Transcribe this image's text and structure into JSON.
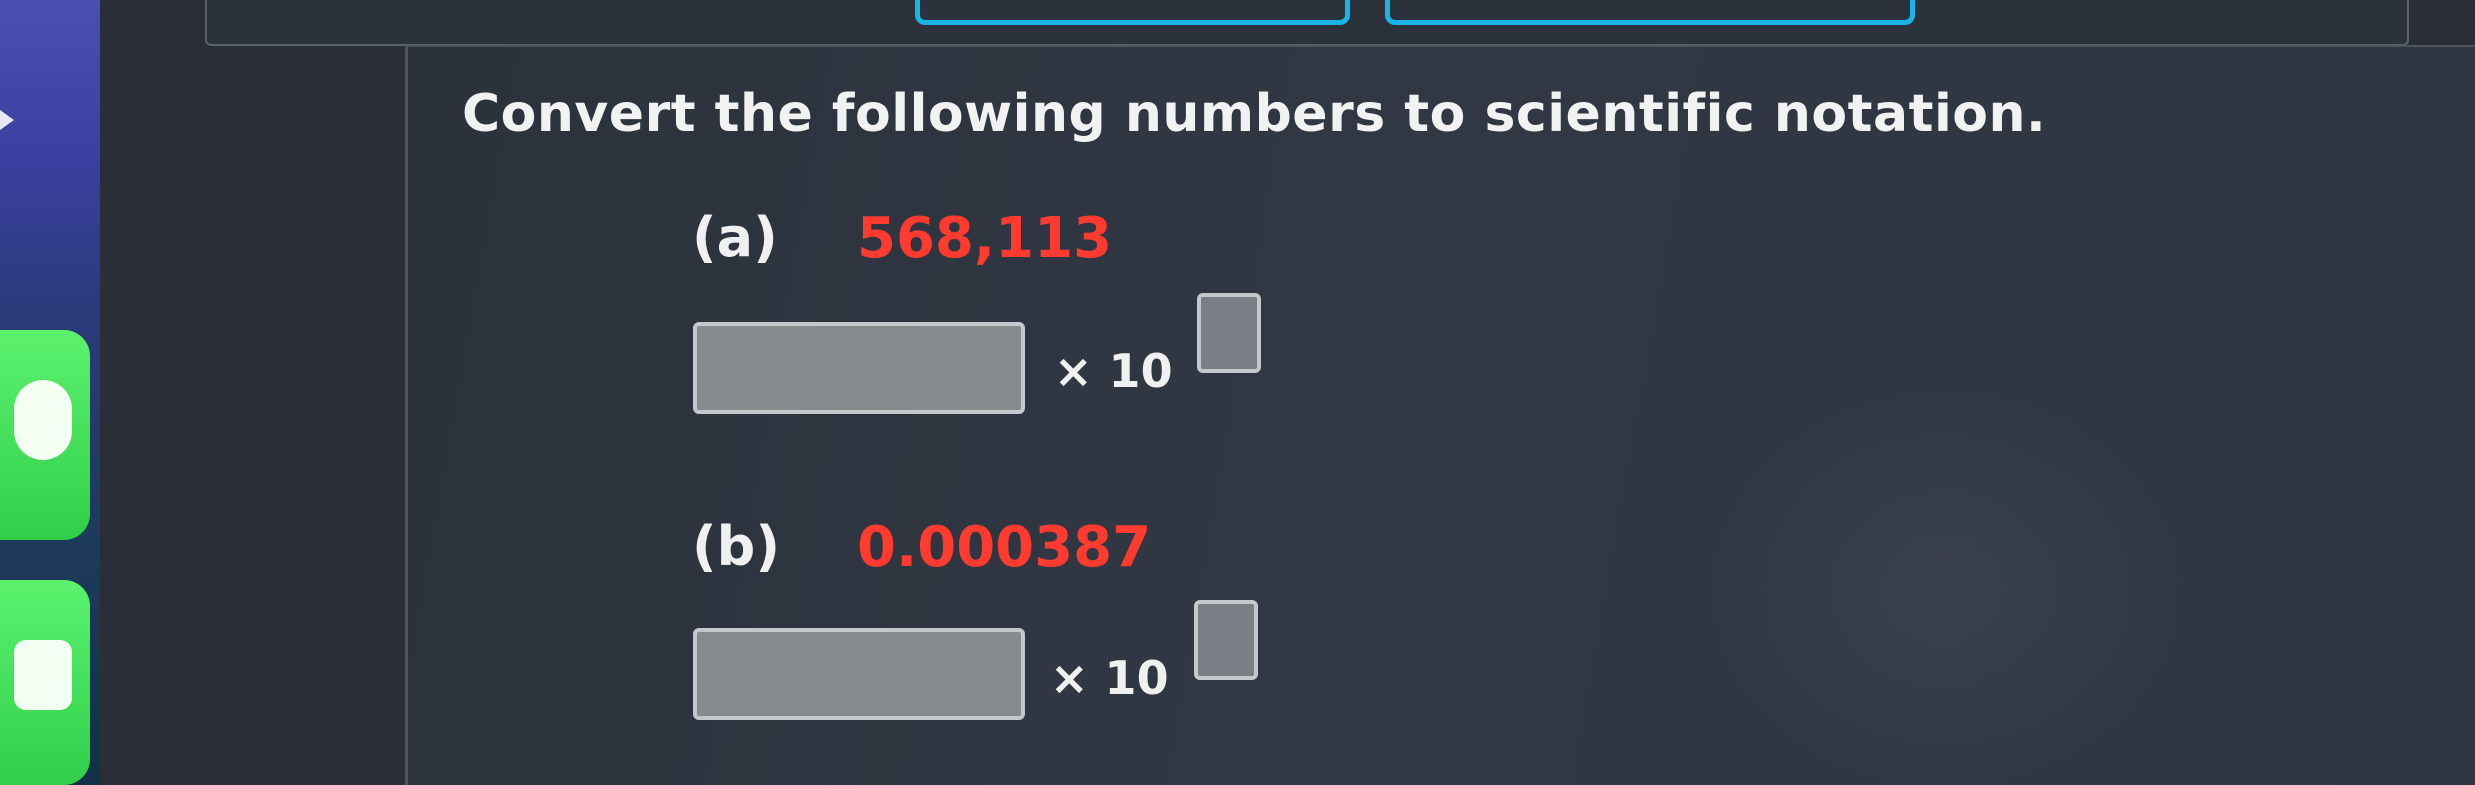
{
  "question": {
    "prompt": "Convert the following numbers to scientific notation."
  },
  "parts": [
    {
      "label": "(a)",
      "value": "568,113",
      "coefficient": "",
      "exponent": "",
      "times_ten": "× 10"
    },
    {
      "label": "(b)",
      "value": "0.000387",
      "coefficient": "",
      "exponent": "",
      "times_ten": "× 10"
    }
  ],
  "colors": {
    "value_text": "#ff3b30",
    "tab_accent": "#1ab6e8",
    "input_fill": "#868b90",
    "background": "#2f3541"
  },
  "dock": {
    "icons": [
      "messages-app-icon",
      "facetime-app-icon"
    ]
  }
}
